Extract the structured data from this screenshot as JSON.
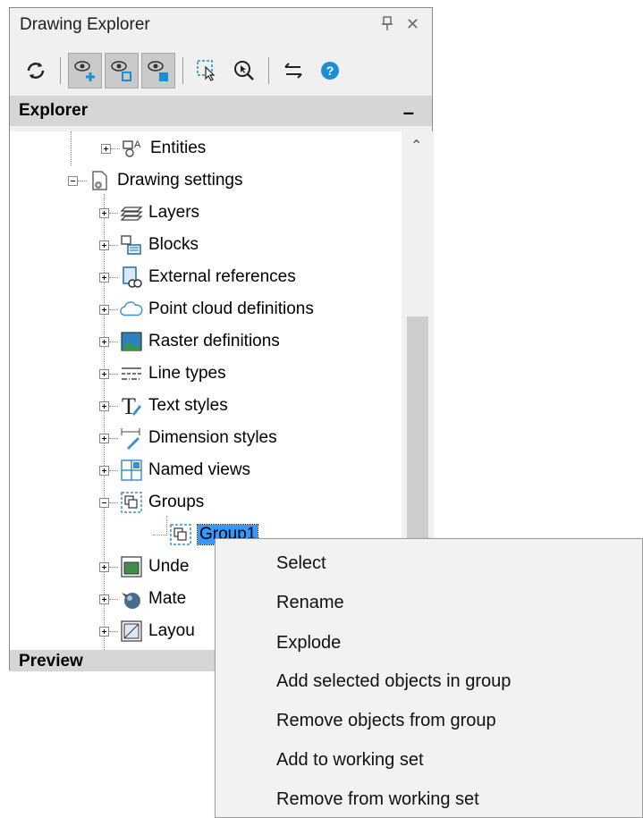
{
  "window": {
    "title": "Drawing Explorer",
    "pin_glyph": "↕",
    "close_glyph": "✕"
  },
  "toolbar": {
    "buttons": [
      {
        "icon": "refresh-icon"
      },
      {
        "icon": "eye-add-icon"
      },
      {
        "icon": "eye-outline-icon"
      },
      {
        "icon": "eye-filled-icon"
      },
      {
        "icon": "select-cursor-icon"
      },
      {
        "icon": "zoom-pick-icon"
      },
      {
        "icon": "swap-arrows-icon"
      },
      {
        "icon": "help-icon",
        "glyph": "?"
      }
    ]
  },
  "explorer": {
    "header": "Explorer",
    "collapse_glyph": "–"
  },
  "tree": {
    "items": [
      {
        "label": "Entities",
        "icon": "entities-icon"
      },
      {
        "label": "Drawing settings",
        "icon": "drawing-settings-icon"
      },
      {
        "label": "Layers",
        "icon": "layers-icon"
      },
      {
        "label": "Blocks",
        "icon": "blocks-icon"
      },
      {
        "label": "External references",
        "icon": "external-references-icon"
      },
      {
        "label": "Point cloud definitions",
        "icon": "cloud-icon"
      },
      {
        "label": "Raster definitions",
        "icon": "raster-icon"
      },
      {
        "label": "Line types",
        "icon": "line-types-icon"
      },
      {
        "label": "Text styles",
        "icon": "text-styles-icon"
      },
      {
        "label": "Dimension styles",
        "icon": "dimension-styles-icon"
      },
      {
        "label": "Named views",
        "icon": "named-views-icon"
      },
      {
        "label": "Groups",
        "icon": "groups-icon"
      },
      {
        "label": "Group1",
        "icon": "group-icon"
      },
      {
        "label": "Unde",
        "icon": "underlay-icon"
      },
      {
        "label": "Mate",
        "icon": "materials-icon"
      },
      {
        "label": "Layou",
        "icon": "layouts-icon"
      }
    ]
  },
  "preview": {
    "header": "Preview"
  },
  "context_menu": {
    "items": [
      "Select",
      "Rename",
      "Explode",
      "Add selected objects in group",
      "Remove objects from group",
      "Add to working set",
      "Remove from working set"
    ]
  },
  "colors": {
    "selection": "#3399ff",
    "accent_blue": "#1a8fd6",
    "panel": "#f0f0f0"
  }
}
